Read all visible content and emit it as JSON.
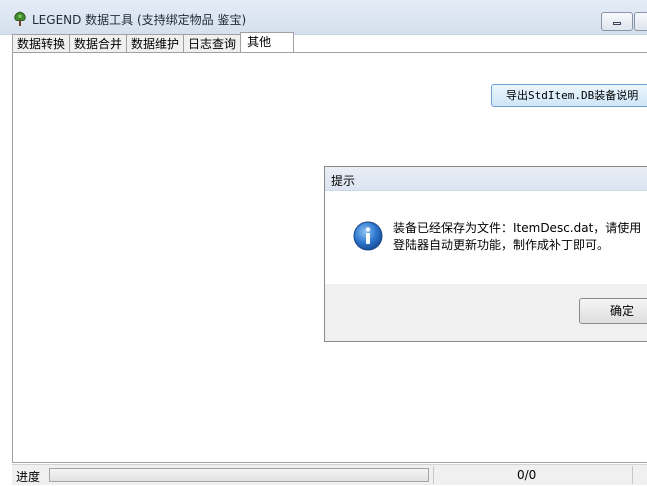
{
  "window": {
    "title": "LEGEND 数据工具 (支持绑定物品 鉴宝)",
    "icon": "tree-app-icon"
  },
  "tabs": [
    {
      "label": "数据转换",
      "active": false
    },
    {
      "label": "数据合并",
      "active": false
    },
    {
      "label": "数据维护",
      "active": false
    },
    {
      "label": "日志查询",
      "active": false
    },
    {
      "label": "其他",
      "active": true
    }
  ],
  "panel": {
    "export_button_label": "导出StdItem.DB装备说明"
  },
  "dialog": {
    "title": "提示",
    "icon": "info-icon",
    "message_line1": "装备已经保存为文件：ItemDesc.dat，请使用",
    "message_line2": "登陆器自动更新功能，制作成补丁即可。",
    "ok_label": "确定"
  },
  "status": {
    "progress_label": "进度",
    "progress_fraction": 0,
    "count_text": "0/0"
  }
}
